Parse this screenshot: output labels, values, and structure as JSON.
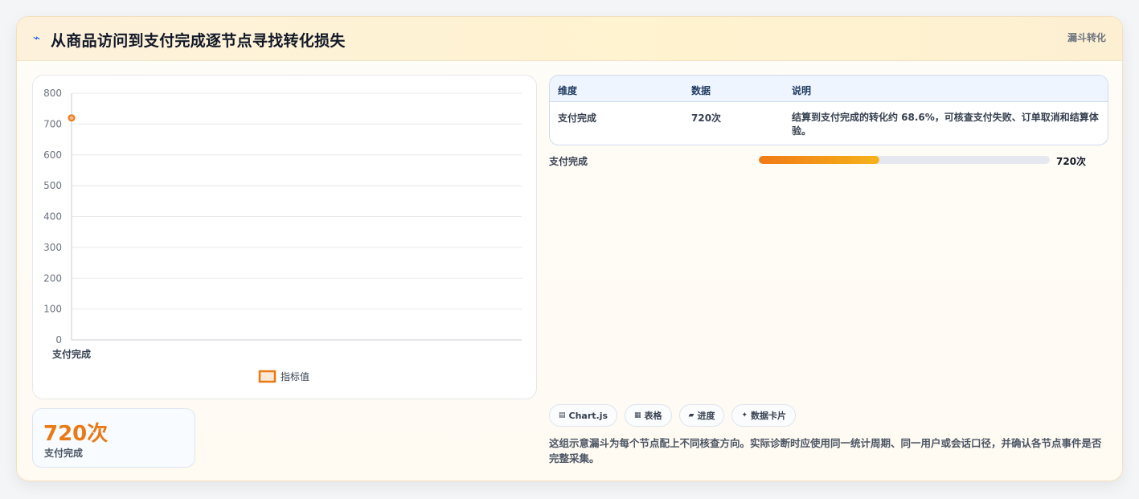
{
  "header": {
    "title_icon": "bolt-icon",
    "title": "从商品访问到支付完成逐节点寻找转化损失",
    "tag": "漏斗转化"
  },
  "chart_data": {
    "type": "line",
    "categories": [
      "支付完成"
    ],
    "series": [
      {
        "name": "指标值",
        "values": [
          720
        ],
        "color": "#ea7a16"
      }
    ],
    "yticks": [
      "0",
      "100",
      "200",
      "300",
      "400",
      "500",
      "600",
      "700",
      "800"
    ],
    "ylim": [
      0,
      800
    ],
    "grid": true,
    "legend": "bottom-center"
  },
  "kpi": {
    "value": "720次",
    "label": "支付完成"
  },
  "table": {
    "headers": [
      "维度",
      "数据",
      "说明"
    ],
    "rows": [
      {
        "dimension": "支付完成",
        "value": "720次",
        "note": "结算到支付完成的转化约 68.6%，可核查支付失败、订单取消和结算体验。"
      }
    ]
  },
  "progress": {
    "label": "支付完成",
    "fraction": 0.415,
    "value_text": "720次"
  },
  "chips": [
    {
      "icon": "chart-icon",
      "glyph": "▤",
      "label": "Chart.js"
    },
    {
      "icon": "table-icon",
      "glyph": "▦",
      "label": "表格"
    },
    {
      "icon": "progress-icon",
      "glyph": "▰",
      "label": "进度"
    },
    {
      "icon": "sparkle-icon",
      "glyph": "✦",
      "label": "数据卡片"
    }
  ],
  "footnote": "这组示意漏斗为每个节点配上不同核查方向。实际诊断时应使用同一统计周期、同一用户或会话口径，并确认各节点事件是否完整采集。"
}
